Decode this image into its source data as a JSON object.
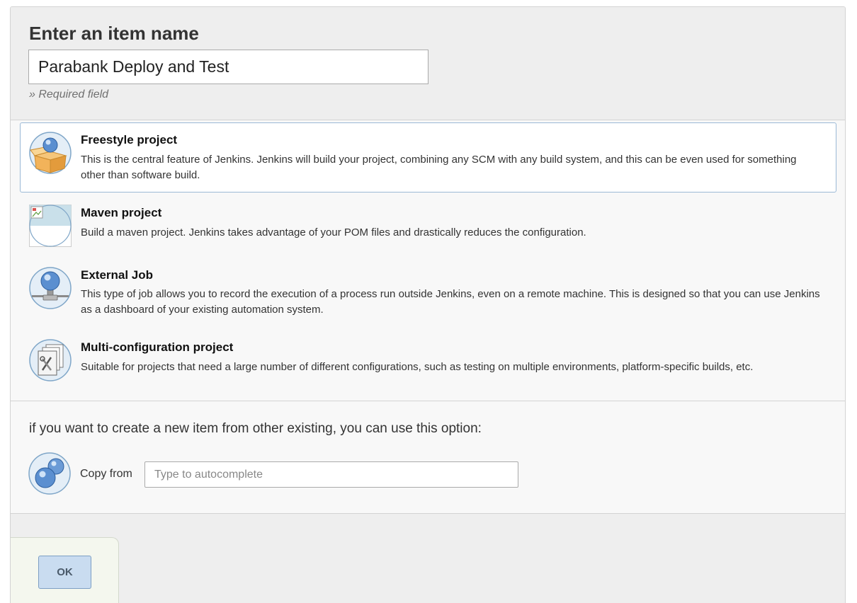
{
  "header": {
    "title": "Enter an item name",
    "name_value": "Parabank Deploy and Test",
    "required_note": "» Required field"
  },
  "items": [
    {
      "title": "Freestyle project",
      "description": "This is the central feature of Jenkins. Jenkins will build your project, combining any SCM with any build system, and this can be even used for something other than software build.",
      "icon": "freestyle-box-icon",
      "selected": true
    },
    {
      "title": "Maven project",
      "description": "Build a maven project. Jenkins takes advantage of your POM files and drastically reduces the configuration.",
      "icon": "broken-image-icon",
      "selected": false
    },
    {
      "title": "External Job",
      "description": "This type of job allows you to record the execution of a process run outside Jenkins, even on a remote machine. This is designed so that you can use Jenkins as a dashboard of your existing automation system.",
      "icon": "globe-network-icon",
      "selected": false
    },
    {
      "title": "Multi-configuration project",
      "description": "Suitable for projects that need a large number of different configurations, such as testing on multiple environments, platform-specific builds, etc.",
      "icon": "multi-config-documents-icon",
      "selected": false
    }
  ],
  "copy": {
    "hint": "if you want to create a new item from other existing, you can use this option:",
    "label": "Copy from",
    "placeholder": "Type to autocomplete",
    "value": "",
    "icon": "copy-spheres-icon"
  },
  "footer": {
    "ok_label": "OK"
  },
  "colors": {
    "selected_border": "#9bb9d6",
    "ok_button": "#c9dcf0",
    "header_bg": "#eeeeee"
  }
}
